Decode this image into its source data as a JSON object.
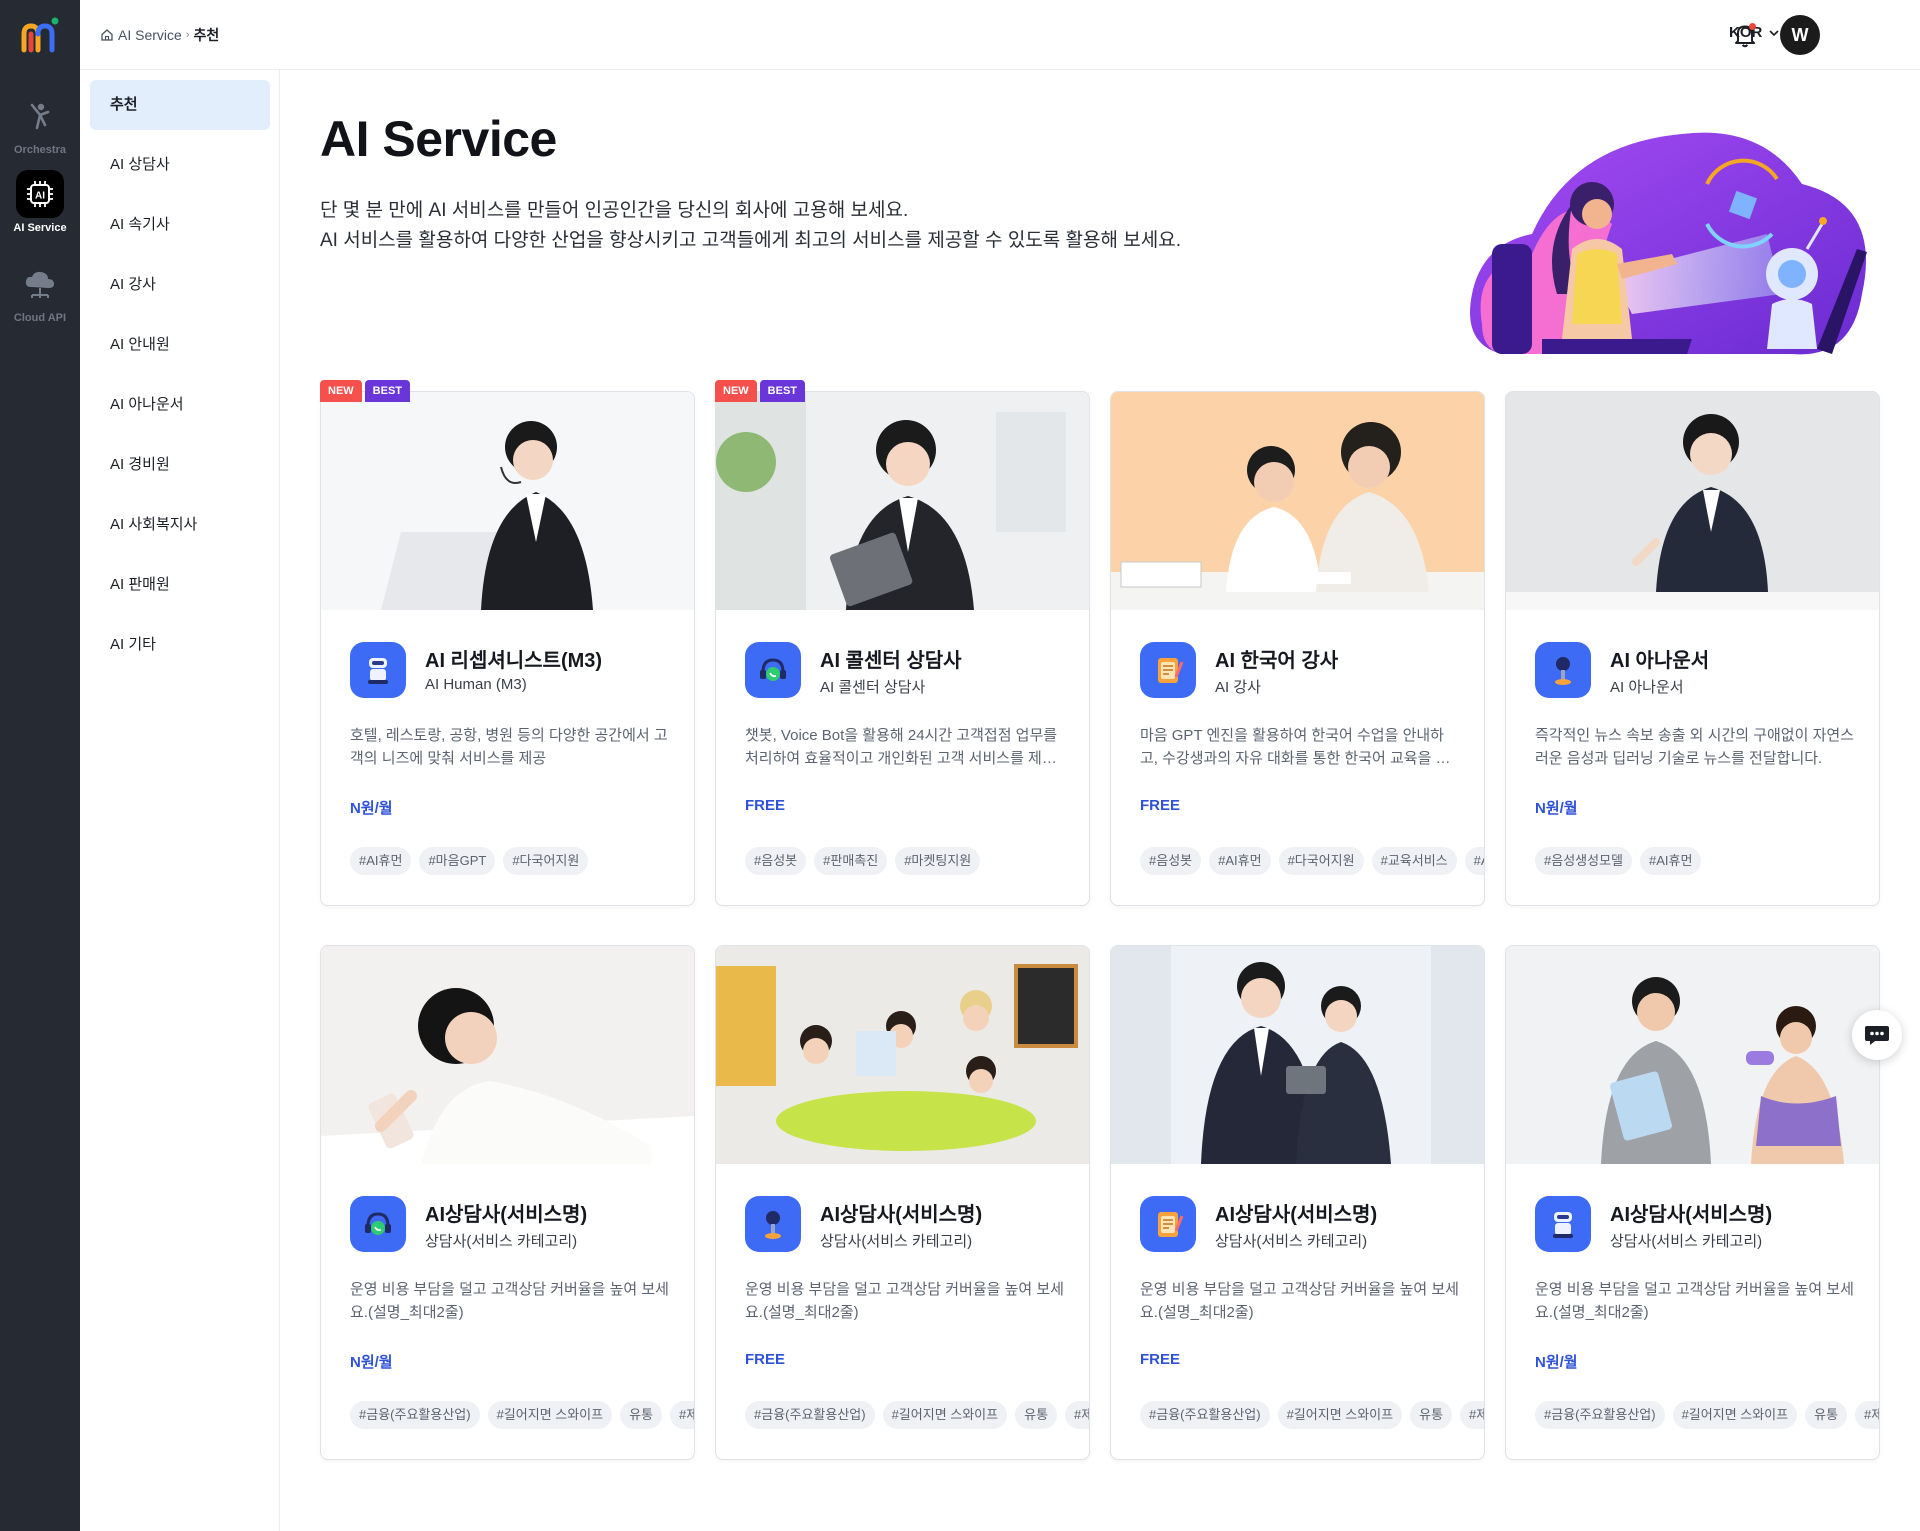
{
  "app": {
    "rail": [
      {
        "label": "Orchestra",
        "icon": "orchestra-icon"
      },
      {
        "label": "AI Service",
        "icon": "ai-chip-icon",
        "active": true
      },
      {
        "label": "Cloud API",
        "icon": "cloud-icon"
      }
    ]
  },
  "topbar": {
    "breadcrumb": {
      "root": "AI Service",
      "current": "추천"
    },
    "language": "KOR",
    "avatar_initial": "W"
  },
  "subnav": {
    "items": [
      "추천",
      "AI 상담사",
      "AI 속기사",
      "AI 강사",
      "AI 안내원",
      "AI 아나운서",
      "AI 경비원",
      "AI 사회복지사",
      "AI 판매원",
      "AI 기타"
    ],
    "active": "추천"
  },
  "hero": {
    "title": "AI Service",
    "line1": "단 몇 분 만에 AI 서비스를 만들어 인공인간을 당신의 회사에 고용해 보세요.",
    "line2": "AI 서비스를 활용하여 다양한 산업을 향상시키고 고객들에게 최고의 서비스를 제공할 수 있도록 활용해 보세요."
  },
  "badges": {
    "new": "NEW",
    "best": "BEST"
  },
  "cards": [
    {
      "title": "AI 리셉셔니스트(M3)",
      "subtitle": "AI Human (M3)",
      "desc": "호텔, 레스토랑, 공항, 병원 등의 다양한 공간에서 고객의 니즈에 맞춰 서비스를 제공",
      "price": "N원/월",
      "tags": [
        "#AI휴먼",
        "#마음GPT",
        "#다국어지원"
      ],
      "icon": "robot-icon",
      "badges": [
        "NEW",
        "BEST"
      ]
    },
    {
      "title": "AI 콜센터 상담사",
      "subtitle": "AI 콜센터 상담사",
      "desc": "챗봇, Voice Bot을 활용해 24시간 고객접점 업무를 처리하여 효율적이고 개인화된 고객 서비스를 제공합니다.",
      "price": "FREE",
      "tags": [
        "#음성봇",
        "#판매촉진",
        "#마켓팅지원"
      ],
      "icon": "headset-icon",
      "badges": [
        "NEW",
        "BEST"
      ]
    },
    {
      "title": "AI 한국어 강사",
      "subtitle": "AI 강사",
      "desc": "마음 GPT 엔진을 활용하여 한국어 수업을 안내하고, 수강생과의 자유 대화를 통한 한국어 교육을 제공합니다.",
      "price": "FREE",
      "tags": [
        "#음성봇",
        "#AI휴먼",
        "#다국어지원",
        "#교육서비스",
        "#AI강사"
      ],
      "icon": "notebook-icon",
      "badges": []
    },
    {
      "title": "AI 아나운서",
      "subtitle": "AI 아나운서",
      "desc": "즉각적인 뉴스 속보 송출 외 시간의 구애없이 자연스러운 음성과 딥러닝 기술로 뉴스를 전달합니다.",
      "price": "N원/월",
      "tags": [
        "#음성생성모델",
        "#AI휴먼"
      ],
      "icon": "microphone-icon",
      "badges": []
    },
    {
      "title": "AI상담사(서비스명)",
      "subtitle": "상담사(서비스 카테고리)",
      "desc": "운영 비용 부담을 덜고 고객상담 커버율을 높여 보세요.(설명_최대2줄)",
      "price": "N원/월",
      "tags": [
        "#금융(주요활용산업)",
        "#길어지면 스와이프",
        "유통",
        "#제조"
      ],
      "icon": "headset-icon",
      "badges": []
    },
    {
      "title": "AI상담사(서비스명)",
      "subtitle": "상담사(서비스 카테고리)",
      "desc": "운영 비용 부담을 덜고 고객상담 커버율을 높여 보세요.(설명_최대2줄)",
      "price": "FREE",
      "tags": [
        "#금융(주요활용산업)",
        "#길어지면 스와이프",
        "유통",
        "#제조"
      ],
      "icon": "microphone-icon",
      "badges": []
    },
    {
      "title": "AI상담사(서비스명)",
      "subtitle": "상담사(서비스 카테고리)",
      "desc": "운영 비용 부담을 덜고 고객상담 커버율을 높여 보세요.(설명_최대2줄)",
      "price": "FREE",
      "tags": [
        "#금융(주요활용산업)",
        "#길어지면 스와이프",
        "유통",
        "#제조"
      ],
      "icon": "notebook-icon",
      "badges": []
    },
    {
      "title": "AI상담사(서비스명)",
      "subtitle": "상담사(서비스 카테고리)",
      "desc": "운영 비용 부담을 덜고 고객상담 커버율을 높여 보세요.(설명_최대2줄)",
      "price": "N원/월",
      "tags": [
        "#금융(주요활용산업)",
        "#길어지면 스와이프",
        "유통",
        "#제조"
      ],
      "icon": "robot-icon",
      "badges": []
    }
  ],
  "colors": {
    "rail_bg": "#262a33",
    "accent_price": "#2f52d9",
    "badge_new": "#f5504c",
    "badge_best": "#6a36d9",
    "subnav_active": "#e3eefd"
  }
}
